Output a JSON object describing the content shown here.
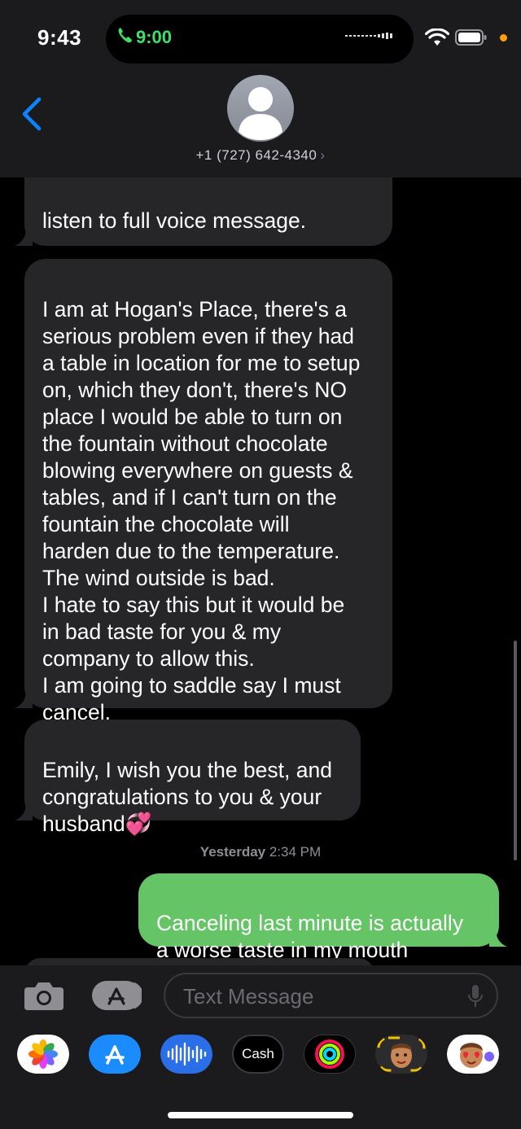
{
  "status": {
    "time": "9:43",
    "call_time": "9:00"
  },
  "header": {
    "contact": "+1 (727) 642-4340",
    "chevron": "›"
  },
  "messages": [
    {
      "dir": "in",
      "text": "listen to full voice message."
    },
    {
      "dir": "in",
      "text": "I am at Hogan's Place, there's a\nserious problem even if they had\na table in location for me to setup\non, which they don't, there's NO\nplace I would be able to turn on\nthe fountain without chocolate\nblowing everywhere on guests &\ntables, and if I can't turn on the\nfountain the chocolate will\nharden due to the temperature.\nThe wind outside is bad.\nI hate to say this but it would be\nin bad taste for you & my\ncompany to allow this.\nI am going to saddle say I must\ncancel."
    },
    {
      "dir": "in",
      "text": "Emily, I wish you the best, and\ncongratulations to you & your\nhusband💞"
    },
    {
      "dir": "out",
      "text": "Canceling last minute is actually\na worse taste in my mouth"
    }
  ],
  "timestamp": {
    "day": "Yesterday",
    "time": "2:34 PM"
  },
  "input": {
    "placeholder": "Text Message"
  },
  "app_drawer": [
    "photos-icon",
    "app-store-icon",
    "audio-message-icon",
    "apple-cash-icon",
    "activity-icon",
    "memoji-icon",
    "memoji-stickers-icon"
  ],
  "apple_cash_label": "Cash",
  "colors": {
    "incoming": "#262628",
    "outgoing": "#65c466",
    "accent": "#0a84ff",
    "call_green": "#3ee06a"
  }
}
